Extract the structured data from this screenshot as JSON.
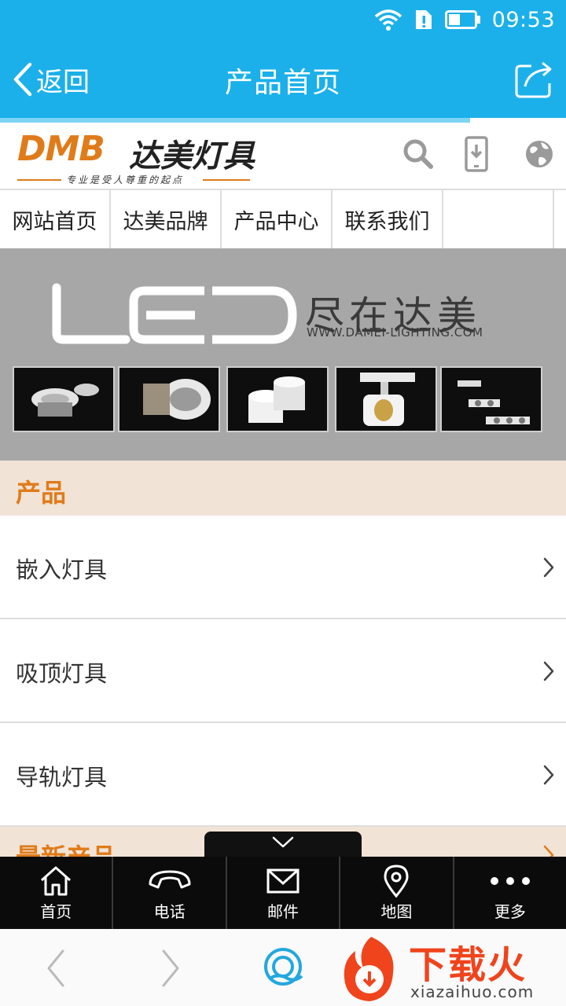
{
  "status": {
    "time": "09:53"
  },
  "appbar": {
    "back_label": "返回",
    "title": "产品首页"
  },
  "page_load_progress": 0.83,
  "logo": {
    "brand_en": "DMB",
    "brand_cn": "达美灯具",
    "slogan": "专业是受人尊重的起点"
  },
  "nav": {
    "items": [
      {
        "label": "网站首页"
      },
      {
        "label": "达美品牌"
      },
      {
        "label": "产品中心"
      },
      {
        "label": "联系我们"
      }
    ]
  },
  "banner": {
    "logo_text": "LED",
    "slogan": "尽在达美",
    "url": "WWW.DAMEI-LIGHTING.COM"
  },
  "products": {
    "section_title": "产品",
    "items": [
      {
        "label": "嵌入灯具"
      },
      {
        "label": "吸顶灯具"
      },
      {
        "label": "导轨灯具"
      }
    ]
  },
  "next_section": {
    "title": "最新产品"
  },
  "bottombar": {
    "items": [
      {
        "label": "首页",
        "icon": "home-icon"
      },
      {
        "label": "电话",
        "icon": "phone-icon"
      },
      {
        "label": "邮件",
        "icon": "mail-icon"
      },
      {
        "label": "地图",
        "icon": "map-pin-icon"
      },
      {
        "label": "更多",
        "icon": "more-icon"
      }
    ]
  },
  "watermark": {
    "text": "下载火",
    "sub": "xiazaihuo.com"
  },
  "colors": {
    "accent_blue": "#1bb0ea",
    "brand_orange": "#e07b1a",
    "section_bg": "#f1e3d6"
  }
}
